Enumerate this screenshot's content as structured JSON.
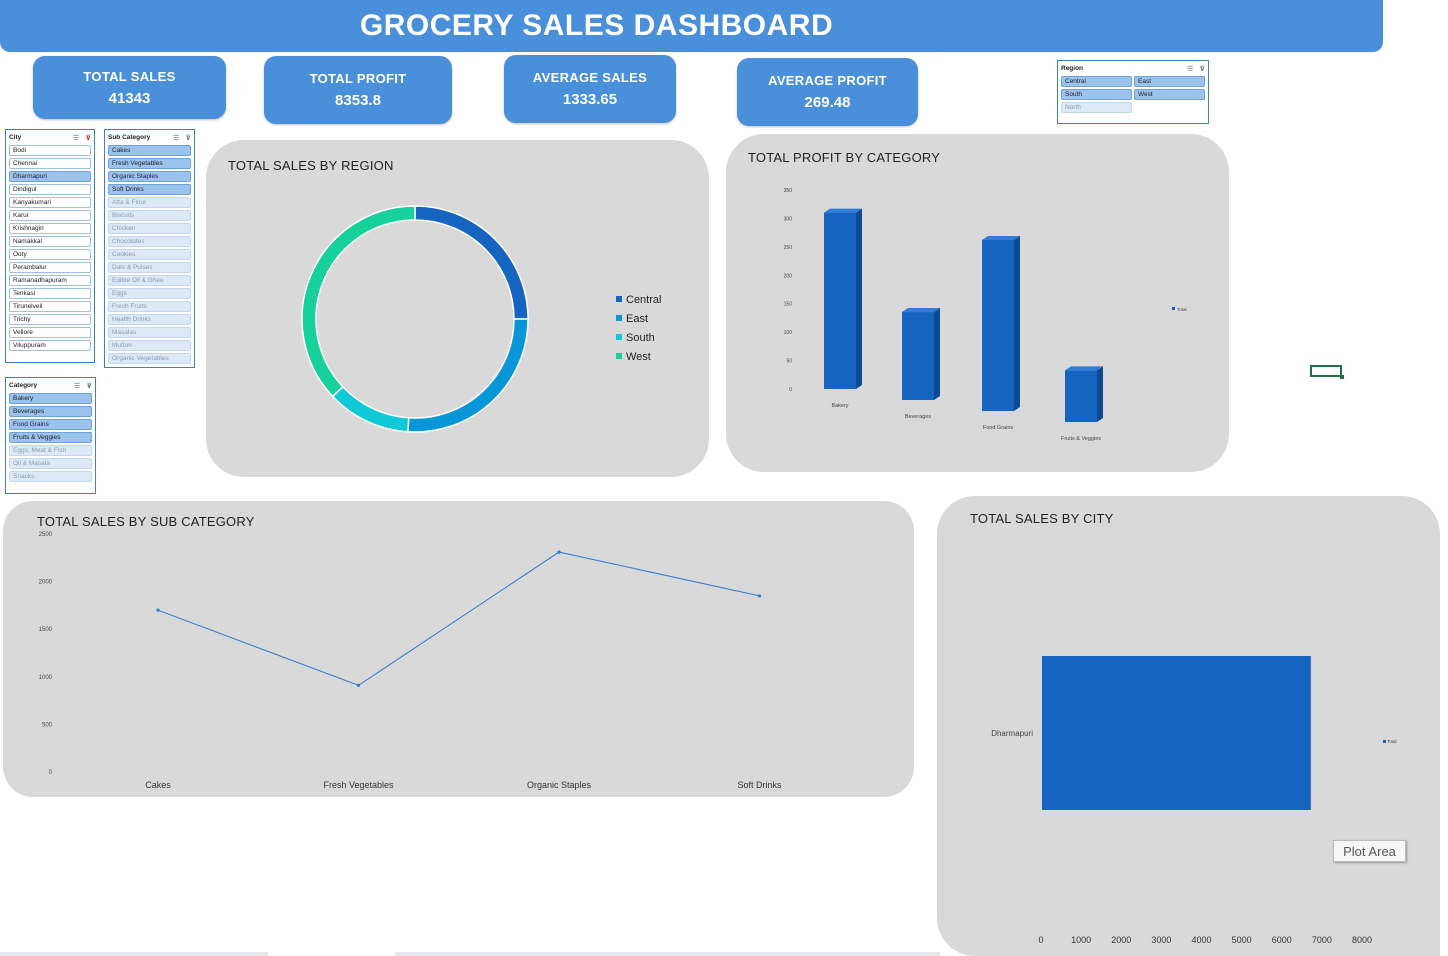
{
  "dashboard": {
    "title": "GROCERY SALES DASHBOARD"
  },
  "kpis": [
    {
      "label": "TOTAL SALES",
      "value": "41343"
    },
    {
      "label": "TOTAL PROFIT",
      "value": "8353.8"
    },
    {
      "label": "AVERAGE SALES",
      "value": "1333.65"
    },
    {
      "label": "AVERAGE PROFIT",
      "value": "269.48"
    }
  ],
  "slicers": {
    "region": {
      "title": "Region",
      "items": [
        {
          "label": "Central",
          "state": "sel"
        },
        {
          "label": "East",
          "state": "sel"
        },
        {
          "label": "South",
          "state": "sel"
        },
        {
          "label": "West",
          "state": "sel"
        },
        {
          "label": "North",
          "state": "dim"
        }
      ]
    },
    "city": {
      "title": "City",
      "items": [
        {
          "label": "Bodi",
          "state": ""
        },
        {
          "label": "Chennai",
          "state": ""
        },
        {
          "label": "Dharmapuri",
          "state": "sel"
        },
        {
          "label": "Dindigul",
          "state": ""
        },
        {
          "label": "Kanyakumari",
          "state": ""
        },
        {
          "label": "Karur",
          "state": ""
        },
        {
          "label": "Krishnagiri",
          "state": ""
        },
        {
          "label": "Namakkal",
          "state": ""
        },
        {
          "label": "Ooty",
          "state": ""
        },
        {
          "label": "Perambalur",
          "state": ""
        },
        {
          "label": "Ramanadhapuram",
          "state": ""
        },
        {
          "label": "Tenkasi",
          "state": ""
        },
        {
          "label": "Tirunelveli",
          "state": ""
        },
        {
          "label": "Trichy",
          "state": ""
        },
        {
          "label": "Vellore",
          "state": ""
        },
        {
          "label": "Viluppuram",
          "state": ""
        }
      ]
    },
    "sub_category": {
      "title": "Sub Category",
      "items": [
        {
          "label": "Cakes",
          "state": "sel"
        },
        {
          "label": "Fresh Vegetables",
          "state": "sel"
        },
        {
          "label": "Organic Staples",
          "state": "sel"
        },
        {
          "label": "Soft Drinks",
          "state": "sel"
        },
        {
          "label": "Atta & Flour",
          "state": "dim"
        },
        {
          "label": "Biscuits",
          "state": "dim"
        },
        {
          "label": "Chicken",
          "state": "dim"
        },
        {
          "label": "Chocolates",
          "state": "dim"
        },
        {
          "label": "Cookies",
          "state": "dim"
        },
        {
          "label": "Dals & Pulses",
          "state": "dim"
        },
        {
          "label": "Edible Oil & Ghee",
          "state": "dim"
        },
        {
          "label": "Eggs",
          "state": "dim"
        },
        {
          "label": "Fresh Fruits",
          "state": "dim"
        },
        {
          "label": "Health Drinks",
          "state": "dim"
        },
        {
          "label": "Masalas",
          "state": "dim"
        },
        {
          "label": "Mutton",
          "state": "dim"
        },
        {
          "label": "Organic Vegetables",
          "state": "dim"
        }
      ]
    },
    "category": {
      "title": "Category",
      "items": [
        {
          "label": "Bakery",
          "state": "sel"
        },
        {
          "label": "Beverages",
          "state": "sel"
        },
        {
          "label": "Food Grains",
          "state": "sel"
        },
        {
          "label": "Fruits & Veggies",
          "state": "sel"
        },
        {
          "label": "Eggs, Meat & Fish",
          "state": "dim"
        },
        {
          "label": "Oil & Masala",
          "state": "dim"
        },
        {
          "label": "Snacks",
          "state": "dim"
        }
      ]
    }
  },
  "chart_data": [
    {
      "id": "region",
      "type": "pie",
      "title": "TOTAL SALES BY REGION",
      "categories": [
        "Central",
        "East",
        "South",
        "West"
      ],
      "values": [
        25,
        26,
        12,
        37
      ],
      "colors": [
        "#1565c0",
        "#0797d8",
        "#10c9d6",
        "#17d19a"
      ],
      "legend": "right"
    },
    {
      "id": "profit_category",
      "type": "bar",
      "title": "TOTAL PROFIT BY CATEGORY",
      "categories": [
        "Bakery",
        "Beverages",
        "Food Grains",
        "Fruits & Veggies"
      ],
      "values": [
        325,
        162,
        315,
        95
      ],
      "ylim": [
        0,
        350
      ],
      "yticks": [
        "0",
        "50",
        "100",
        "150",
        "200",
        "250",
        "300",
        "350"
      ],
      "series": [
        {
          "name": "Total"
        }
      ],
      "legend": "right",
      "color": "#1565c0"
    },
    {
      "id": "sub_category",
      "type": "line",
      "title": "TOTAL SALES BY SUB CATEGORY",
      "categories": [
        "Cakes",
        "Fresh Vegetables",
        "Organic Staples",
        "Soft Drinks"
      ],
      "values": [
        1700,
        910,
        2310,
        1850
      ],
      "ylim": [
        0,
        2500
      ],
      "yticks": [
        "0",
        "500",
        "1000",
        "1500",
        "2000",
        "2500"
      ],
      "color": "#2f7ad0"
    },
    {
      "id": "city",
      "type": "bar",
      "orientation": "horizontal",
      "title": "TOTAL SALES BY CITY",
      "categories": [
        "Dharmapuri"
      ],
      "values": [
        6700
      ],
      "xlim": [
        0,
        8000
      ],
      "xticks": [
        "0",
        "1000",
        "2000",
        "3000",
        "4000",
        "5000",
        "6000",
        "7000",
        "8000"
      ],
      "series": [
        {
          "name": "Total"
        }
      ],
      "legend": "right",
      "color": "#1565c0"
    }
  ],
  "tooltip": {
    "plot_area": "Plot Area"
  }
}
